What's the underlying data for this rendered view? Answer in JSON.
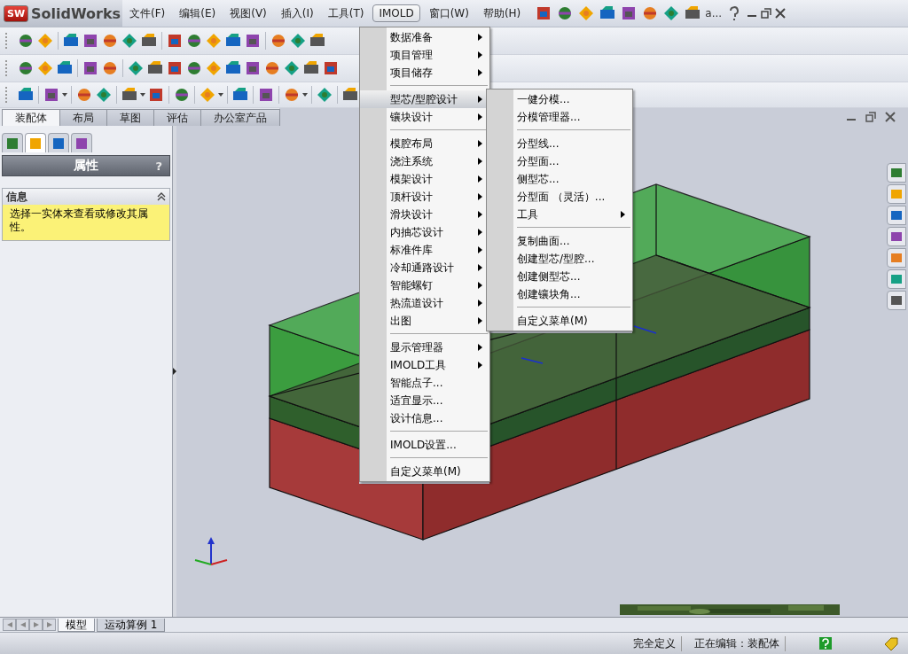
{
  "app": {
    "badge": "SW",
    "name": "SolidWorks"
  },
  "menu_bar": [
    {
      "label": "文件(F)",
      "selected": false
    },
    {
      "label": "编辑(E)",
      "selected": false
    },
    {
      "label": "视图(V)",
      "selected": false
    },
    {
      "label": "插入(I)",
      "selected": false
    },
    {
      "label": "工具(T)",
      "selected": false
    },
    {
      "label": "IMOLD",
      "selected": true
    },
    {
      "label": "窗口(W)",
      "selected": false
    },
    {
      "label": "帮助(H)",
      "selected": false
    }
  ],
  "toolbar_overflow": "a...",
  "command_tabs": [
    {
      "label": "装配体",
      "selected": true
    },
    {
      "label": "布局",
      "selected": false
    },
    {
      "label": "草图",
      "selected": false
    },
    {
      "label": "评估",
      "selected": false
    },
    {
      "label": "办公室产品",
      "selected": false
    }
  ],
  "panel_tabs": [
    {
      "selected": false
    },
    {
      "selected": true
    },
    {
      "selected": false
    },
    {
      "selected": false
    }
  ],
  "property_manager": {
    "title": "属性",
    "help": "?",
    "section": {
      "title": "信息",
      "expanded": true,
      "message": "选择一实体来查看或修改其属性。"
    }
  },
  "imold_menu": [
    {
      "kind": "submenu",
      "label": "数据准备",
      "selected": false
    },
    {
      "kind": "submenu",
      "label": "项目管理",
      "selected": false
    },
    {
      "kind": "submenu",
      "label": "项目储存",
      "selected": false
    },
    {
      "kind": "separator"
    },
    {
      "kind": "submenu",
      "label": "型芯/型腔设计",
      "selected": true
    },
    {
      "kind": "submenu",
      "label": "镶块设计",
      "selected": false
    },
    {
      "kind": "separator"
    },
    {
      "kind": "submenu",
      "label": "模腔布局",
      "selected": false
    },
    {
      "kind": "submenu",
      "label": "浇注系统",
      "selected": false
    },
    {
      "kind": "submenu",
      "label": "模架设计",
      "selected": false
    },
    {
      "kind": "submenu",
      "label": "顶杆设计",
      "selected": false
    },
    {
      "kind": "submenu",
      "label": "滑块设计",
      "selected": false
    },
    {
      "kind": "submenu",
      "label": "内抽芯设计",
      "selected": false
    },
    {
      "kind": "submenu",
      "label": "标准件库",
      "selected": false
    },
    {
      "kind": "submenu",
      "label": "冷却通路设计",
      "selected": false
    },
    {
      "kind": "submenu",
      "label": "智能螺钉",
      "selected": false
    },
    {
      "kind": "submenu",
      "label": "热流道设计",
      "selected": false
    },
    {
      "kind": "submenu",
      "label": "出图",
      "selected": false
    },
    {
      "kind": "separator"
    },
    {
      "kind": "submenu",
      "label": "显示管理器",
      "selected": false
    },
    {
      "kind": "submenu",
      "label": "IMOLD工具",
      "selected": false
    },
    {
      "kind": "command",
      "label": "智能点子...",
      "selected": false
    },
    {
      "kind": "command",
      "label": "适宜显示...",
      "selected": false
    },
    {
      "kind": "command",
      "label": "设计信息...",
      "selected": false
    },
    {
      "kind": "separator"
    },
    {
      "kind": "command",
      "label": "IMOLD设置...",
      "selected": false
    },
    {
      "kind": "separator"
    },
    {
      "kind": "command",
      "label": "自定义菜单(M)",
      "selected": false
    }
  ],
  "core_cavity_submenu": [
    {
      "kind": "command",
      "label": "一健分模...",
      "selected": false
    },
    {
      "kind": "command",
      "label": "分模管理器...",
      "selected": false
    },
    {
      "kind": "separator"
    },
    {
      "kind": "command",
      "label": "分型线...",
      "selected": false
    },
    {
      "kind": "command",
      "label": "分型面...",
      "selected": false
    },
    {
      "kind": "command",
      "label": "侧型芯...",
      "selected": false
    },
    {
      "kind": "command",
      "label": "分型面 （灵活）...",
      "selected": false
    },
    {
      "kind": "submenu",
      "label": "工具",
      "selected": false
    },
    {
      "kind": "separator"
    },
    {
      "kind": "command",
      "label": "复制曲面...",
      "selected": false
    },
    {
      "kind": "command",
      "label": "创建型芯/型腔...",
      "selected": false
    },
    {
      "kind": "command",
      "label": "创建侧型芯...",
      "selected": false
    },
    {
      "kind": "command",
      "label": "创建镶块角...",
      "selected": false
    },
    {
      "kind": "separator"
    },
    {
      "kind": "command",
      "label": "自定义菜单(M)",
      "selected": false
    }
  ],
  "bottom_tabs": [
    {
      "label": "模型",
      "selected": true
    },
    {
      "label": "运动算例 1",
      "selected": false
    }
  ],
  "status_bar": [
    "完全定义",
    "正在编辑：装配体"
  ]
}
